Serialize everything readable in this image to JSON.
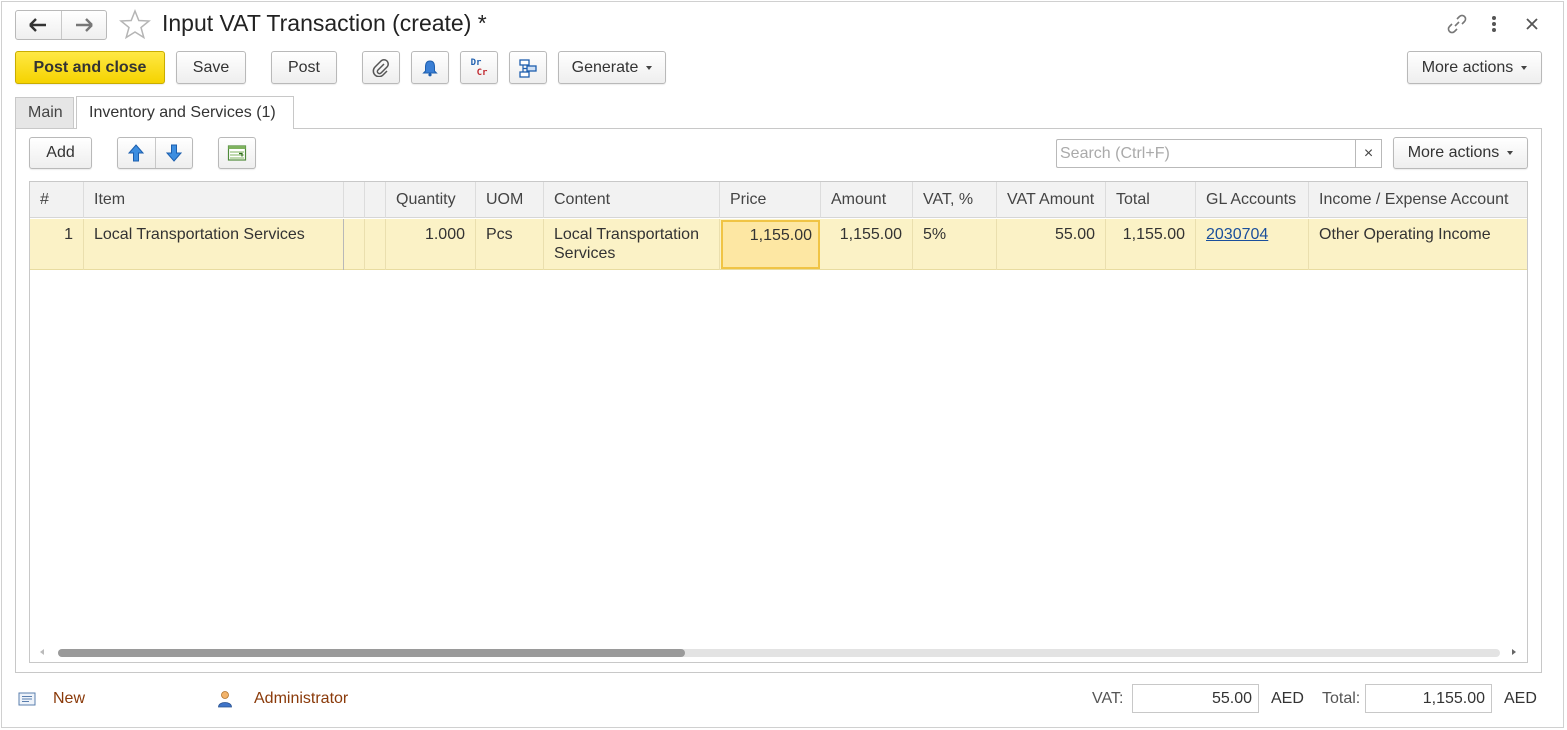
{
  "window": {
    "title": "Input VAT Transaction (create) *"
  },
  "toolbar": {
    "post_and_close": "Post and close",
    "save": "Save",
    "post": "Post",
    "drcr_top": "Dr",
    "drcr_bottom": "Cr",
    "generate": "Generate",
    "more_actions": "More actions"
  },
  "tabs": [
    {
      "label": "Main",
      "active": false
    },
    {
      "label": "Inventory and Services (1)",
      "active": true
    }
  ],
  "table_toolbar": {
    "add": "Add",
    "search_placeholder": "Search (Ctrl+F)",
    "search_clear": "×",
    "more_actions": "More actions"
  },
  "table": {
    "columns": [
      "#",
      "Item",
      "",
      "",
      "Quantity",
      "UOM",
      "Content",
      "Price",
      "Amount",
      "VAT, %",
      "VAT Amount",
      "Total",
      "GL Accounts",
      "Income / Expense Account"
    ],
    "rows": [
      {
        "num": "1",
        "item": "Local Transportation Services",
        "quantity": "1.000",
        "uom": "Pcs",
        "content": "Local Transportation Services",
        "price": "1,155.00",
        "amount": "1,155.00",
        "vat_percent": "5%",
        "vat_amount": "55.00",
        "total": "1,155.00",
        "gl_accounts": "2030704",
        "income_expense_account": "Other Operating Income"
      }
    ]
  },
  "footer": {
    "status": "New",
    "user": "Administrator",
    "vat_label": "VAT:",
    "vat_value": "55.00",
    "vat_currency": "AED",
    "total_label": "Total:",
    "total_value": "1,155.00",
    "total_currency": "AED"
  },
  "colors": {
    "primary_button": "#f5d300",
    "selected_row": "#fbf2c6",
    "active_cell": "#fde7a3",
    "link": "#1a4f9c",
    "footer_text": "#8a3a0a"
  }
}
